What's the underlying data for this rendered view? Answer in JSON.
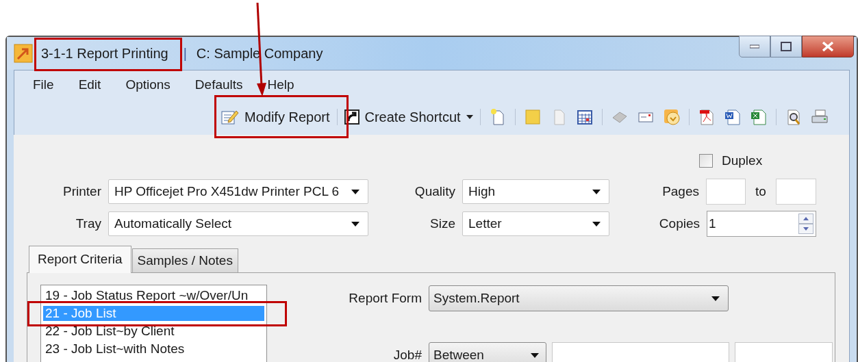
{
  "window": {
    "title": "3-1-1 Report Printing",
    "title_separator": "|",
    "company": "C: Sample Company"
  },
  "menu": [
    "File",
    "Edit",
    "Options",
    "Defaults",
    "Help"
  ],
  "toolbar": {
    "modify_report": "Modify Report",
    "create_shortcut": "Create Shortcut"
  },
  "print_settings": {
    "duplex": {
      "label": "Duplex",
      "checked": false
    },
    "printer": {
      "label": "Printer",
      "value": "HP Officejet Pro X451dw Printer PCL 6"
    },
    "tray": {
      "label": "Tray",
      "value": "Automatically Select"
    },
    "quality": {
      "label": "Quality",
      "value": "High"
    },
    "size": {
      "label": "Size",
      "value": "Letter"
    },
    "pages": {
      "label": "Pages",
      "to_label": "to"
    },
    "copies": {
      "label": "Copies",
      "value": "1"
    }
  },
  "tabs": [
    {
      "label": "Report Criteria",
      "selected": true
    },
    {
      "label": "Samples / Notes",
      "selected": false
    }
  ],
  "report_list": [
    {
      "label": "19 - Job Status Report ~w/Over/Un",
      "selected": false
    },
    {
      "label": "21 - Job List",
      "selected": true
    },
    {
      "label": "22 - Job List~by Client",
      "selected": false
    },
    {
      "label": "23 - Job List~with Notes",
      "selected": false
    }
  ],
  "report_form": {
    "label": "Report Form",
    "value": "System.Report"
  },
  "job": {
    "label": "Job#",
    "operator": "Between"
  }
}
